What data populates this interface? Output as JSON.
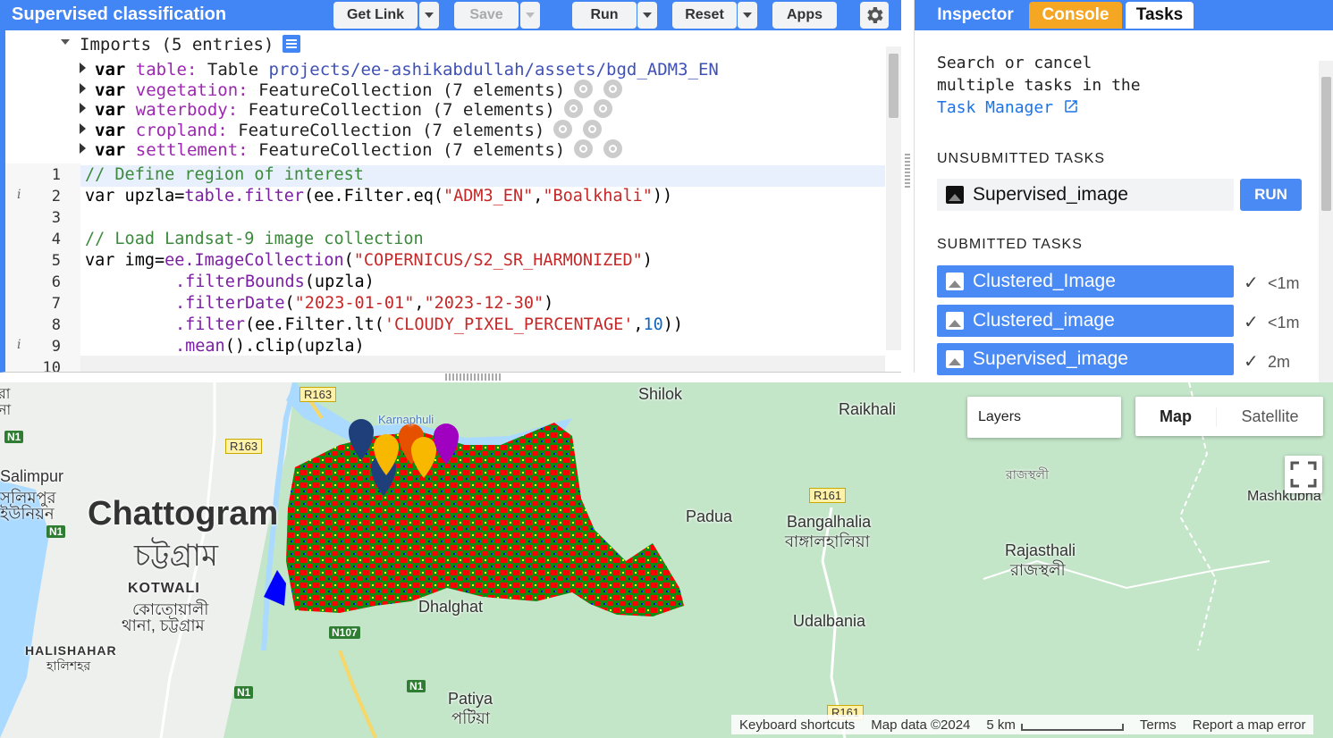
{
  "header": {
    "title": "Supervised classification",
    "buttons": {
      "get_link": "Get Link",
      "save": "Save",
      "run": "Run",
      "reset": "Reset",
      "apps": "Apps"
    }
  },
  "imports": {
    "summary": "Imports (5 entries)",
    "entries": [
      {
        "kw": "var",
        "name": "table:",
        "type": "Table",
        "value": "projects/ee-ashikabdullah/assets/bgd_ADM3_EN"
      },
      {
        "kw": "var",
        "name": "vegetation:",
        "type": "FeatureCollection (7 elements)"
      },
      {
        "kw": "var",
        "name": "waterbody:",
        "type": "FeatureCollection (7 elements)"
      },
      {
        "kw": "var",
        "name": "cropland:",
        "type": "FeatureCollection (7 elements)"
      },
      {
        "kw": "var",
        "name": "settlement:",
        "type": "FeatureCollection (7 elements)"
      }
    ]
  },
  "code": {
    "line_numbers": [
      "1",
      "2",
      "3",
      "4",
      "5",
      "6",
      "7",
      "8",
      "9",
      "10"
    ],
    "lines": {
      "l1": "// Define region of interest",
      "l2a": "var upzla=",
      "l2b": "table.filter",
      "l2c": "(ee.Filter.eq(",
      "l2d": "\"ADM3_EN\"",
      "l2e": ",",
      "l2f": "\"Boalkhali\"",
      "l2g": "))",
      "l4": "// Load Landsat-9 image collection",
      "l5a": "var img=",
      "l5b": "ee.ImageCollection",
      "l5c": "(",
      "l5d": "\"COPERNICUS/S2_SR_HARMONIZED\"",
      "l5e": ")",
      "l6a": ".filterBounds",
      "l6b": "(upzla)",
      "l7a": ".filterDate",
      "l7b": "(",
      "l7c": "\"2023-01-01\"",
      "l7d": ",",
      "l7e": "\"2023-12-30\"",
      "l7f": ")",
      "l8a": ".filter",
      "l8b": "(ee.Filter.lt(",
      "l8c": "'CLOUDY_PIXEL_PERCENTAGE'",
      "l8d": ",",
      "l8e": "10",
      "l8f": "))",
      "l9a": ".mean",
      "l9b": "().clip(upzla)"
    }
  },
  "right_panel": {
    "tabs": [
      "Inspector",
      "Console",
      "Tasks"
    ],
    "manager_text": [
      "Search or cancel",
      "multiple tasks in the"
    ],
    "manager_link": "Task Manager",
    "unsubmitted_heading": "UNSUBMITTED TASKS",
    "unsubmitted": [
      {
        "name": "Supervised_image",
        "button": "RUN"
      }
    ],
    "submitted_heading": "SUBMITTED TASKS",
    "submitted": [
      {
        "name": "Clustered_Image",
        "time": "<1m"
      },
      {
        "name": "Clustered_image",
        "time": "<1m"
      },
      {
        "name": "Supervised_image",
        "time": "2m"
      }
    ]
  },
  "map": {
    "layers_label": "Layers",
    "map_button": "Map",
    "satellite_button": "Satellite",
    "places": {
      "chattogram": "Chattogram",
      "chattogram_bn": "চট্টগ্রাম",
      "shilok": "Shilok",
      "raikhali": "Raikhali",
      "padua": "Padua",
      "bangalhalia": "Bangalhalia",
      "bangalhalia_bn": "বাঙ্গালহালিয়া",
      "rajasthali": "Rajasthali",
      "rajasthali_bn": "রাজস্থলী",
      "rajasthali_bn2": "রাজস্থলী",
      "udalbania": "Udalbania",
      "dhalghat": "Dhalghat",
      "patiya": "Patiya",
      "patiya_bn": "পটিয়া",
      "kotwali": "KOTWALI",
      "kotwali_bn1": "কোতোয়ালী",
      "kotwali_bn2": "থানা, চট্টগ্রাম",
      "halishahar": "HALISHAHAR",
      "halishahar_bn": "হালিশহর",
      "salimpur": "Salimpur",
      "salimpur_bn1": "সলিমপুর",
      "salimpur_bn2": "ইউনিয়ন",
      "mashkubna": "Mashkubna",
      "ra": "রা",
      "na": "না",
      "karnaphuli": "Karnaphuli"
    },
    "roads": {
      "r163a": "R163",
      "r163b": "R163",
      "r161a": "R161",
      "r161b": "R161",
      "n107": "N107",
      "n1a": "N1",
      "n1b": "N1",
      "n1c": "N1",
      "n1d": "N1"
    },
    "footer": {
      "shortcuts": "Keyboard shortcuts",
      "data": "Map data ©2024",
      "scale": "5 km",
      "terms": "Terms",
      "report": "Report a map error"
    },
    "classification_colors": {
      "vegetation": "#118c11",
      "settlement": "#ff0000",
      "cropland": "#ffff00",
      "waterbody": "#0000ff"
    }
  }
}
